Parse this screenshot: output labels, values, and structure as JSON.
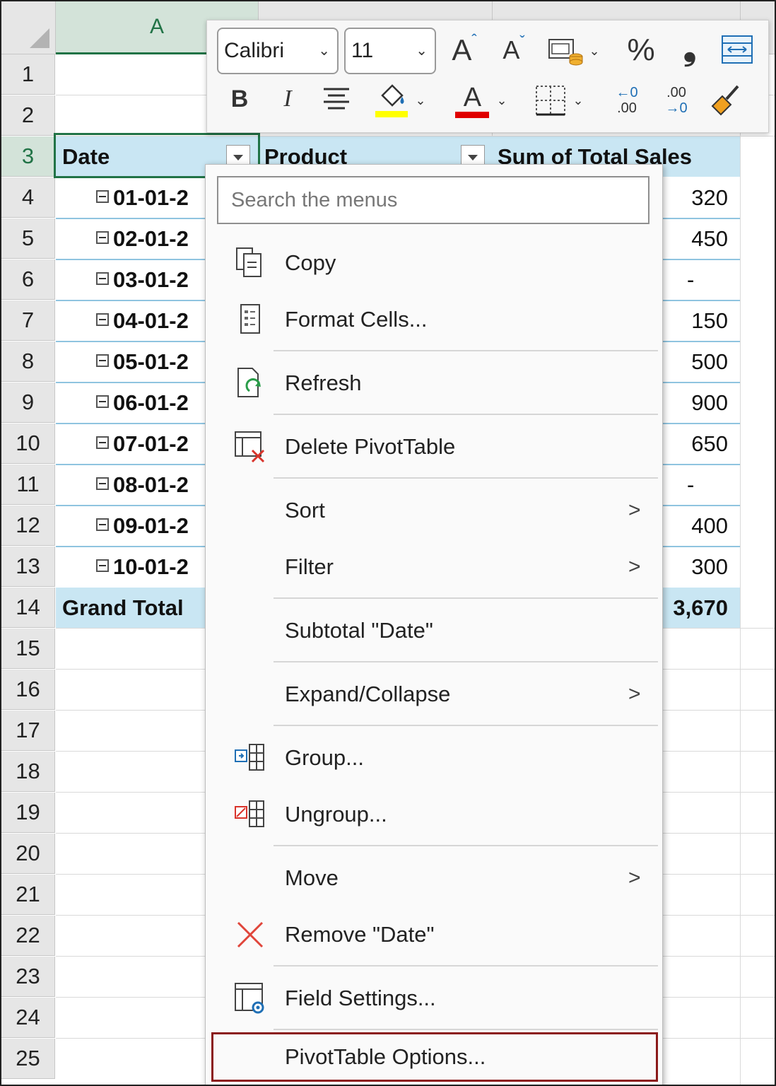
{
  "sheet": {
    "columns": [
      "A"
    ],
    "rows": [
      "1",
      "2",
      "3",
      "4",
      "5",
      "6",
      "7",
      "8",
      "9",
      "10",
      "11",
      "12",
      "13",
      "14",
      "15",
      "16",
      "17",
      "18",
      "19",
      "20",
      "21",
      "22",
      "23",
      "24",
      "25"
    ]
  },
  "pivot": {
    "header": {
      "date": "Date",
      "product": "Product",
      "sales": "Sum of Total Sales"
    },
    "rows": [
      {
        "date": "01-01-2",
        "sales": "320"
      },
      {
        "date": "02-01-2",
        "sales": "450"
      },
      {
        "date": "03-01-2",
        "sales": "-"
      },
      {
        "date": "04-01-2",
        "sales": "150"
      },
      {
        "date": "05-01-2",
        "sales": "500"
      },
      {
        "date": "06-01-2",
        "sales": "900"
      },
      {
        "date": "07-01-2",
        "sales": "650"
      },
      {
        "date": "08-01-2",
        "sales": "-"
      },
      {
        "date": "09-01-2",
        "sales": "400"
      },
      {
        "date": "10-01-2",
        "sales": "300"
      }
    ],
    "grand_total": {
      "label": "Grand Total",
      "sales": "3,670"
    }
  },
  "mini_toolbar": {
    "font": "Calibri",
    "size": "11",
    "bold": "B",
    "italic": "I",
    "percent": "%",
    "comma": "❟",
    "increase_font": "A",
    "decrease_font": "A",
    "font_color_letter": "A",
    "inc_decimal_a": "←0",
    "inc_decimal_b": ".00",
    "dec_decimal_a": ".00",
    "dec_decimal_b": "→0",
    "highlight_color": "#ffff00",
    "font_color": "#e00000"
  },
  "context_menu": {
    "search_placeholder": "Search the menus",
    "items": {
      "copy": "Copy",
      "format_cells": "Format Cells...",
      "refresh": "Refresh",
      "delete_pivot": "Delete PivotTable",
      "sort": "Sort",
      "filter": "Filter",
      "subtotal": "Subtotal \"Date\"",
      "expand_collapse": "Expand/Collapse",
      "group": "Group...",
      "ungroup": "Ungroup...",
      "move": "Move",
      "remove": "Remove \"Date\"",
      "field_settings": "Field Settings...",
      "pivot_options": "PivotTable Options..."
    },
    "submenu_arrow": ">"
  },
  "colors": {
    "pivot_band": "#c9e6f3",
    "excel_green": "#217346",
    "highlight_border": "#8b1a1a"
  }
}
